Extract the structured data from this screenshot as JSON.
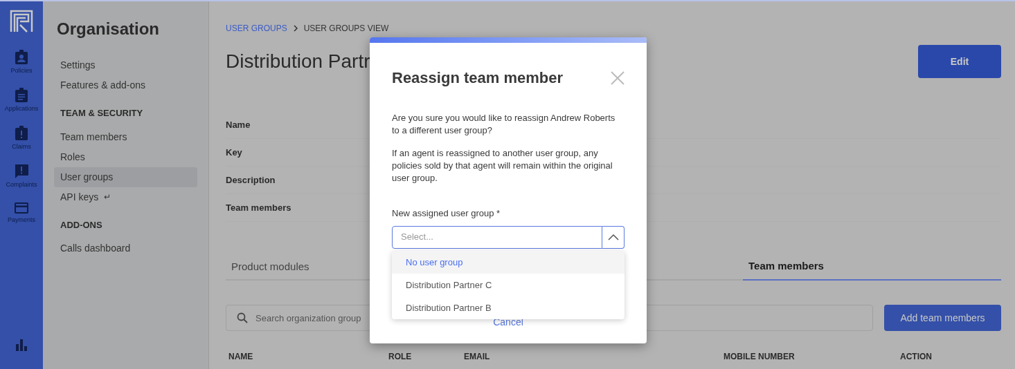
{
  "rail": {
    "items": [
      {
        "kind": "policies",
        "label": "Policies"
      },
      {
        "kind": "applications",
        "label": "Applications"
      },
      {
        "kind": "claims",
        "label": "Claims"
      },
      {
        "kind": "complaints",
        "label": "Complaints"
      },
      {
        "kind": "payments",
        "label": "Payments"
      }
    ]
  },
  "sidebar": {
    "title": "Organisation",
    "sections": [
      {
        "items": [
          {
            "label": "Settings",
            "selected": false
          },
          {
            "label": "Features & add-ons",
            "selected": false
          }
        ]
      },
      {
        "heading": "TEAM & SECURITY",
        "items": [
          {
            "label": "Team members",
            "selected": false
          },
          {
            "label": "Roles",
            "selected": false
          },
          {
            "label": "User groups",
            "selected": true
          },
          {
            "label": "API keys",
            "selected": false,
            "suffix": "↵"
          }
        ]
      },
      {
        "heading": "ADD-ONS",
        "items": [
          {
            "label": "Calls dashboard",
            "selected": false
          }
        ]
      }
    ]
  },
  "breadcrumb": [
    {
      "label": "USER GROUPS",
      "link": true
    },
    {
      "label": "USER GROUPS VIEW",
      "link": false
    }
  ],
  "page_title": "Distribution Partr",
  "edit_button": "Edit",
  "details": [
    "Name",
    "Key",
    "Description",
    "Team members"
  ],
  "tabs": [
    {
      "label": "Product modules",
      "selected": false
    },
    {
      "label": "Team members",
      "selected": true
    }
  ],
  "search": {
    "placeholder": "Search organization group"
  },
  "add_button": "Add team members",
  "table": {
    "columns": [
      "NAME",
      "ROLE",
      "EMAIL",
      "MOBILE NUMBER",
      "ACTION"
    ]
  },
  "modal": {
    "title": "Reassign team member",
    "paragraphs": [
      "Are you sure you would like to reassign Andrew Roberts to a different user group?",
      "If an agent is reassigned to another user group, any policies sold by that agent will remain within the original user group."
    ],
    "field_label": "New assigned user group *",
    "placeholder": "Select...",
    "expanded": true,
    "options": [
      {
        "label": "No user group",
        "selected": true
      },
      {
        "label": "Distribution Partner C",
        "selected": false
      },
      {
        "label": "Distribution Partner B",
        "selected": false
      }
    ],
    "cancel": "Cancel"
  }
}
